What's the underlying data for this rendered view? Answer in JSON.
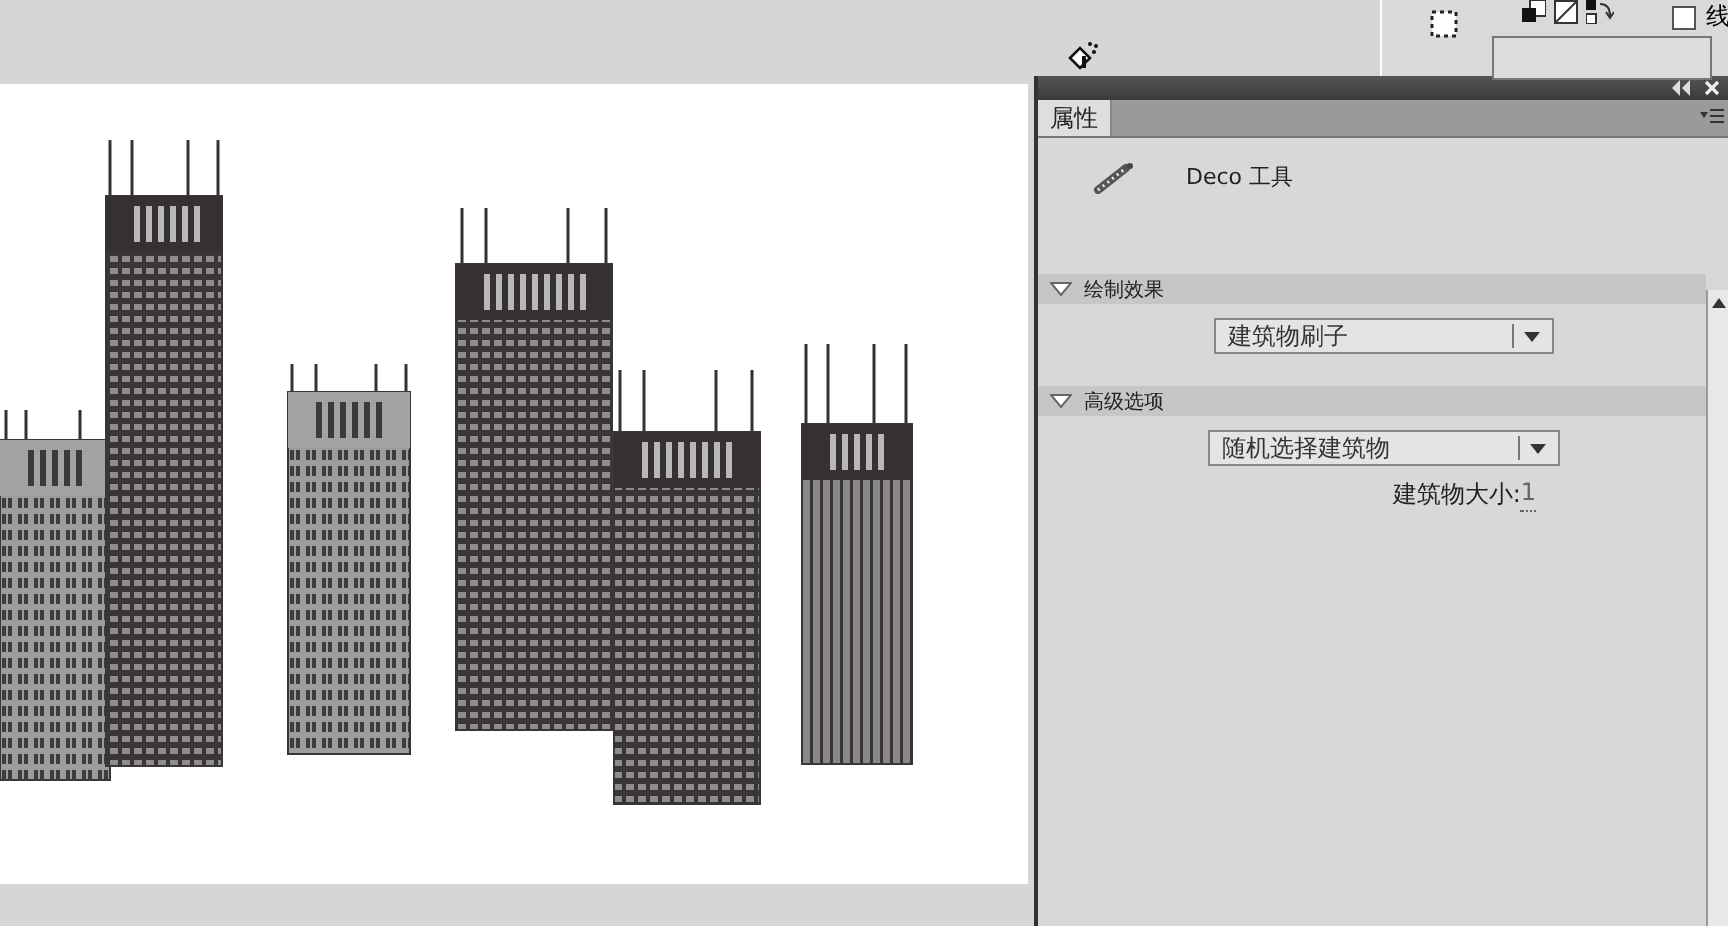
{
  "toolbar": {
    "checkbox": {
      "label": "线",
      "checked": false
    }
  },
  "panel": {
    "tabs": [
      {
        "label": "属性",
        "selected": true
      }
    ],
    "tool_name": "Deco 工具",
    "sections": [
      {
        "title": "绘制效果",
        "expanded": true,
        "dropdown": "建筑物刷子"
      },
      {
        "title": "高级选项",
        "expanded": true,
        "dropdown": "随机选择建筑物",
        "field_label": "建筑物大小:",
        "field_value": "1"
      }
    ]
  }
}
